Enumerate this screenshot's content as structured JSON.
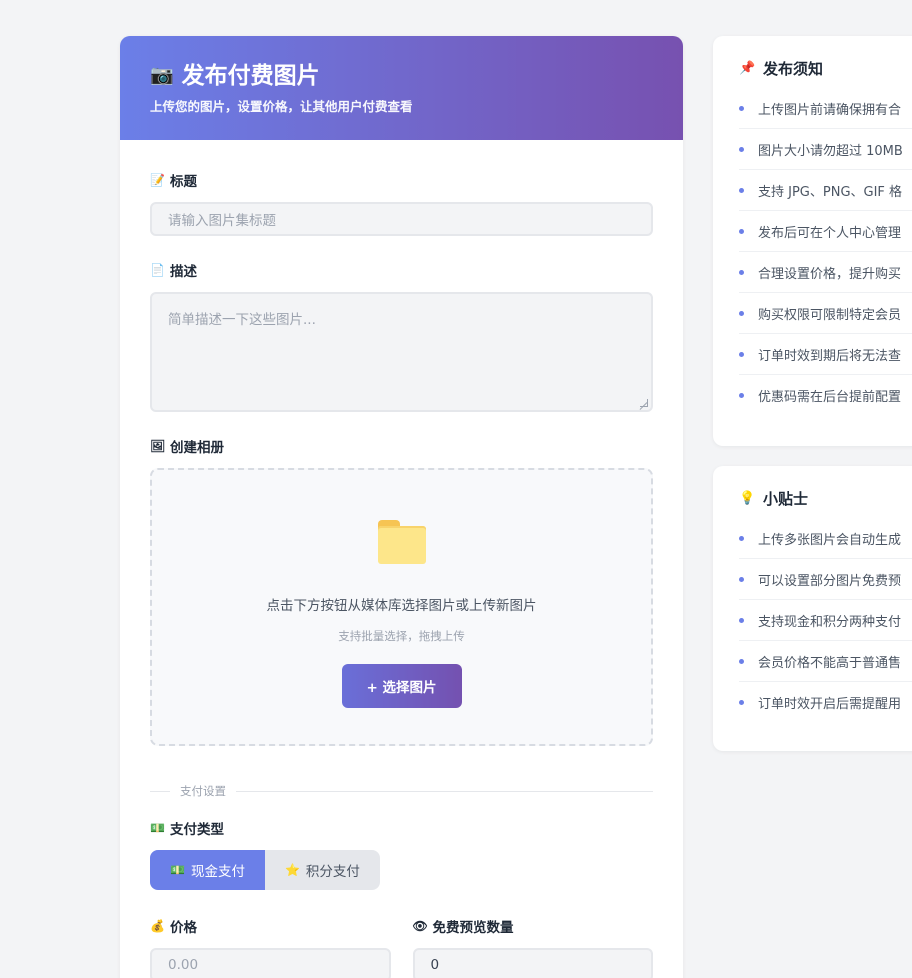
{
  "header": {
    "title_icon": "camera-icon",
    "title": "发布付费图片",
    "subtitle": "上传您的图片，设置价格，让其他用户付费查看"
  },
  "form": {
    "title_field": {
      "icon": "memo-icon",
      "label": "标题",
      "placeholder": "请输入图片集标题"
    },
    "desc_field": {
      "icon": "page-icon",
      "label": "描述",
      "placeholder": "简单描述一下这些图片..."
    },
    "album": {
      "icon": "picture-icon",
      "label": "创建相册",
      "dropzone_text": "点击下方按钮从媒体库选择图片或上传新图片",
      "dropzone_hint": "支持批量选择，拖拽上传",
      "button_label": "+ 选择图片"
    },
    "payment_section": "支付设置",
    "payment_type": {
      "icon": "money-icon",
      "label": "支付类型",
      "options": [
        {
          "icon": "💵",
          "label": "现金支付",
          "active": true
        },
        {
          "icon": "⭐",
          "label": "积分支付",
          "active": false
        }
      ]
    },
    "price": {
      "icon": "money-bag-icon",
      "label": "价格",
      "placeholder": "0.00"
    },
    "free_preview": {
      "icon": "eye-icon",
      "label": "免费预览数量",
      "value": "0"
    }
  },
  "notice": {
    "icon": "pin-icon",
    "title": "发布须知",
    "items": [
      "上传图片前请确保拥有合",
      "图片大小请勿超过 10MB",
      "支持 JPG、PNG、GIF 格",
      "发布后可在个人中心管理",
      "合理设置价格，提升购买",
      "购买权限可限制特定会员",
      "订单时效到期后将无法查",
      "优惠码需在后台提前配置"
    ]
  },
  "tips": {
    "icon": "bulb-icon",
    "title": "小贴士",
    "items": [
      "上传多张图片会自动生成",
      "可以设置部分图片免费预",
      "支持现金和积分两种支付",
      "会员价格不能高于普通售",
      "订单时效开启后需提醒用"
    ]
  },
  "colors": {
    "accent": "#6b7fe8",
    "header_gradient_start": "#6b7fe8",
    "header_gradient_end": "#7751b0"
  }
}
